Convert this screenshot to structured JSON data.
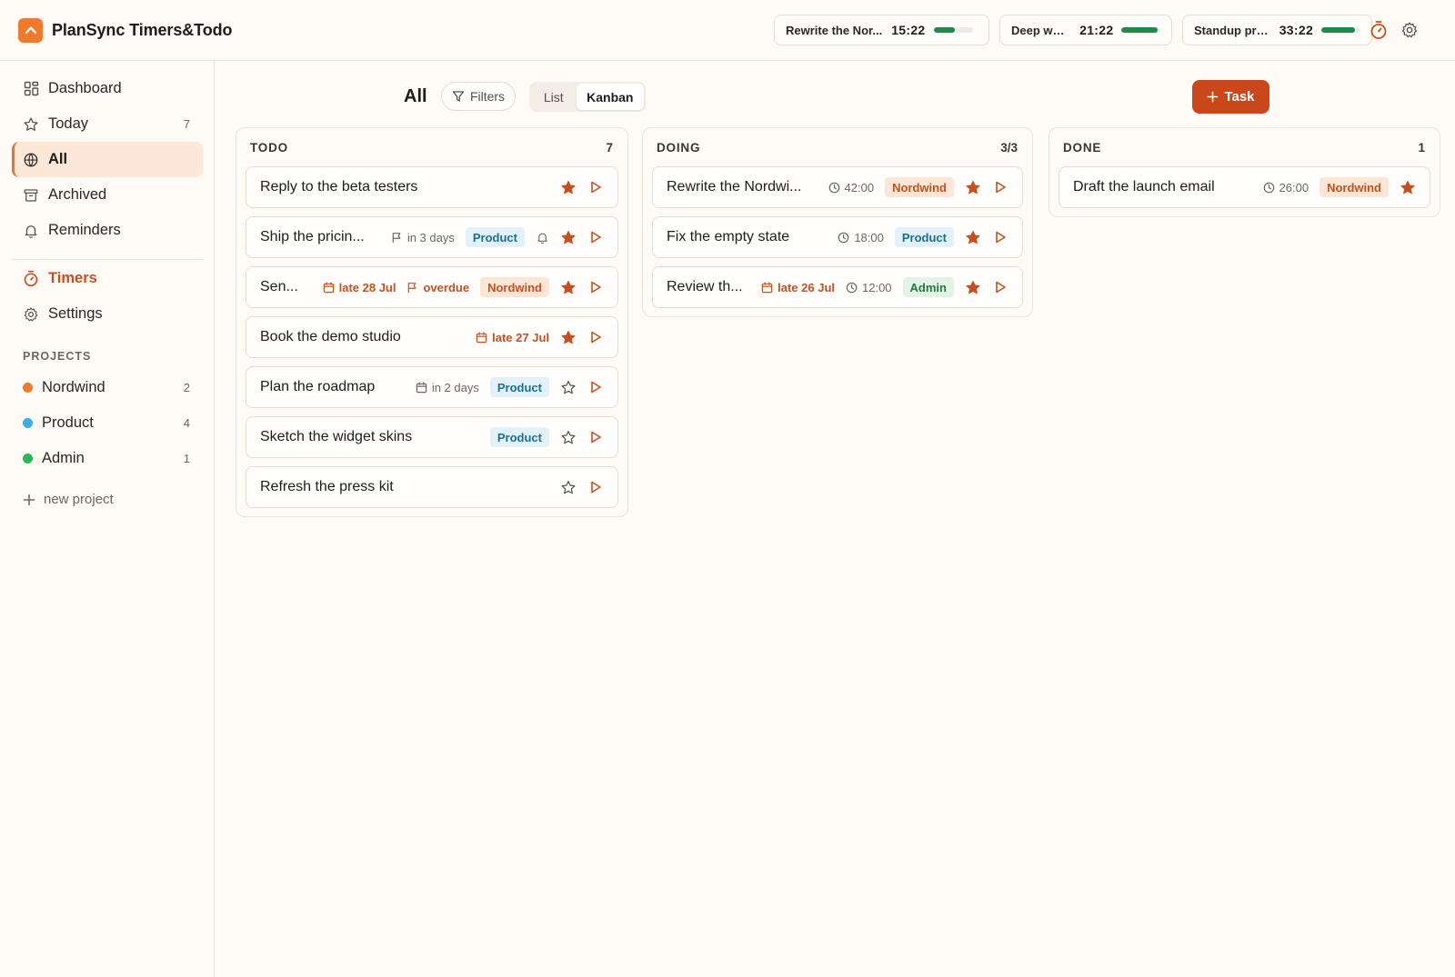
{
  "app": {
    "title": "PlanSync Timers&Todo",
    "accent": "#c9471a"
  },
  "header": {
    "timers": [
      {
        "label": "Rewrite the Nor...",
        "time": "15:22",
        "progress": 0.55
      },
      {
        "label": "Deep work",
        "time": "21:22",
        "progress": 0.92
      },
      {
        "label": "Standup prep",
        "time": "33:22",
        "progress": 0.86
      }
    ],
    "icons": [
      "stopwatch-icon",
      "gear-icon"
    ]
  },
  "sidebar": {
    "nav": [
      {
        "label": "Dashboard",
        "count": "",
        "icon": "grid-icon"
      },
      {
        "label": "Today",
        "count": "7",
        "icon": "star-icon"
      },
      {
        "label": "All",
        "count": "",
        "icon": "globe-icon",
        "active": true
      },
      {
        "label": "Archived",
        "count": "",
        "icon": "archive-icon"
      },
      {
        "label": "Reminders",
        "count": "",
        "icon": "bell-icon"
      }
    ],
    "tools": [
      {
        "label": "Timers",
        "icon": "stopwatch-icon"
      },
      {
        "label": "Settings",
        "icon": "gear-icon"
      }
    ],
    "projects_label": "PROJECTS",
    "projects": [
      {
        "label": "Nordwind",
        "count": "2",
        "color": "#f07a2c"
      },
      {
        "label": "Product",
        "count": "4",
        "color": "#3aaee6"
      },
      {
        "label": "Admin",
        "count": "1",
        "color": "#27b955"
      }
    ],
    "new_project": "new project"
  },
  "toolbar": {
    "title": "All",
    "filters_label": "Filters",
    "views": [
      "List",
      "Kanban"
    ],
    "active_view": "Kanban",
    "add_label": "Task"
  },
  "columns": [
    {
      "title": "TODO",
      "count": "7",
      "cards": [
        {
          "title": "Reply to the beta testers",
          "starred": true
        },
        {
          "title": "Ship the pricin...",
          "flag": "in 3 days",
          "tag": "Product",
          "bell": true,
          "starred": true
        },
        {
          "title": "Sen...",
          "date": "late 28 Jul",
          "flag": "overdue",
          "tag": "Nordwind",
          "starred": true
        },
        {
          "title": "Book the demo studio",
          "date": "late 27 Jul",
          "starred": true
        },
        {
          "title": "Plan the roadmap",
          "date": "in 2 days",
          "tag": "Product",
          "starred": false
        },
        {
          "title": "Sketch the widget skins",
          "tag": "Product",
          "starred": false
        },
        {
          "title": "Refresh the press kit",
          "starred": false
        }
      ]
    },
    {
      "title": "DOING",
      "count": "3/3",
      "cards": [
        {
          "title": "Rewrite the Nordwi...",
          "duration": "42:00",
          "tag": "Nordwind",
          "starred": true
        },
        {
          "title": "Fix the empty state",
          "duration": "18:00",
          "tag": "Product",
          "starred": true
        },
        {
          "title": "Review th...",
          "date": "late 26 Jul",
          "duration": "12:00",
          "tag": "Admin",
          "starred": true
        }
      ]
    },
    {
      "title": "DONE",
      "count": "1",
      "cards": [
        {
          "title": "Draft the launch email",
          "duration": "26:00",
          "tag": "Nordwind",
          "starred": true,
          "no_play": true
        }
      ]
    }
  ]
}
